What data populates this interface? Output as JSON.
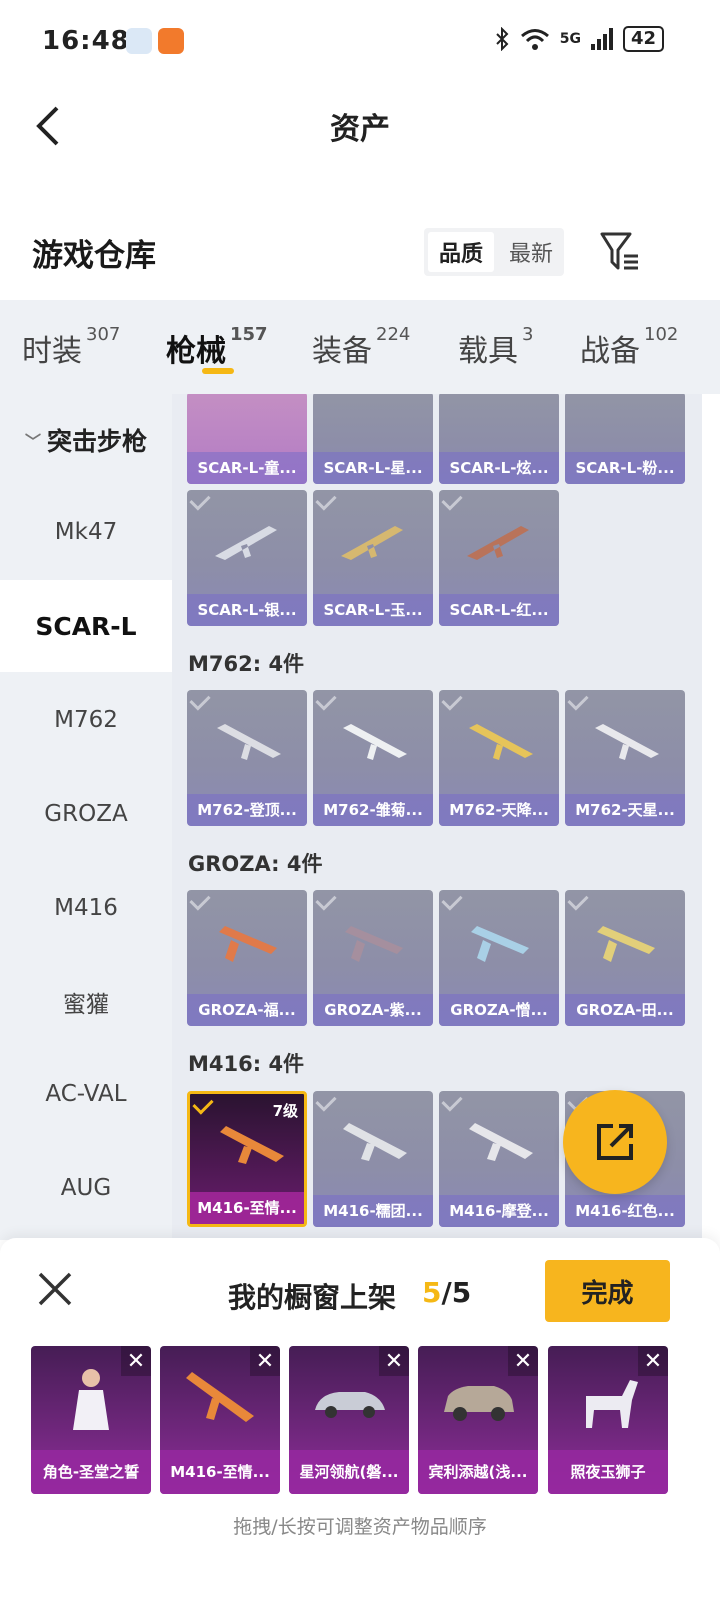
{
  "status": {
    "time": "16:48",
    "network": "5G",
    "battery": "42"
  },
  "nav": {
    "title": "资产"
  },
  "warehouse": {
    "title": "游戏仓库",
    "sort": [
      "品质",
      "最新"
    ]
  },
  "tabs": [
    {
      "label": "时装",
      "count": "307"
    },
    {
      "label": "枪械",
      "count": "157"
    },
    {
      "label": "装备",
      "count": "224"
    },
    {
      "label": "载具",
      "count": "3"
    },
    {
      "label": "战备",
      "count": "102"
    }
  ],
  "sidebar": {
    "category": "突击步枪",
    "items": [
      "Mk47",
      "SCAR-L",
      "M762",
      "GROZA",
      "M416",
      "蜜獾",
      "AC-VAL",
      "AUG"
    ]
  },
  "groups": {
    "scar_top": [
      "SCAR-L-童...",
      "SCAR-L-星...",
      "SCAR-L-炫...",
      "SCAR-L-粉..."
    ],
    "scar_row2": [
      "SCAR-L-银...",
      "SCAR-L-玉...",
      "SCAR-L-红..."
    ],
    "m762": {
      "label": "M762: 4件",
      "items": [
        "M762-登顶...",
        "M762-雏菊...",
        "M762-天降...",
        "M762-天星..."
      ]
    },
    "groza": {
      "label": "GROZA: 4件",
      "items": [
        "GROZA-福...",
        "GROZA-紫...",
        "GROZA-憎...",
        "GROZA-田..."
      ]
    },
    "m416": {
      "label": "M416: 4件",
      "level": "7级",
      "items": [
        "M416-至情...",
        "M416-糯团...",
        "M416-摩登...",
        "M416-红色..."
      ]
    }
  },
  "panel": {
    "title": "我的橱窗上架",
    "count_current": "5",
    "count_total": "/5",
    "done": "完成",
    "items": [
      "角色-圣堂之誓",
      "M416-至情...",
      "星河领航(磐...",
      "宾利添越(浅...",
      "照夜玉狮子"
    ],
    "hint": "拖拽/长按可调整资产物品顺序"
  },
  "colors": {
    "accent": "#f5b815",
    "tile": "#8d8ea8",
    "legendary": "#8e2e99"
  }
}
